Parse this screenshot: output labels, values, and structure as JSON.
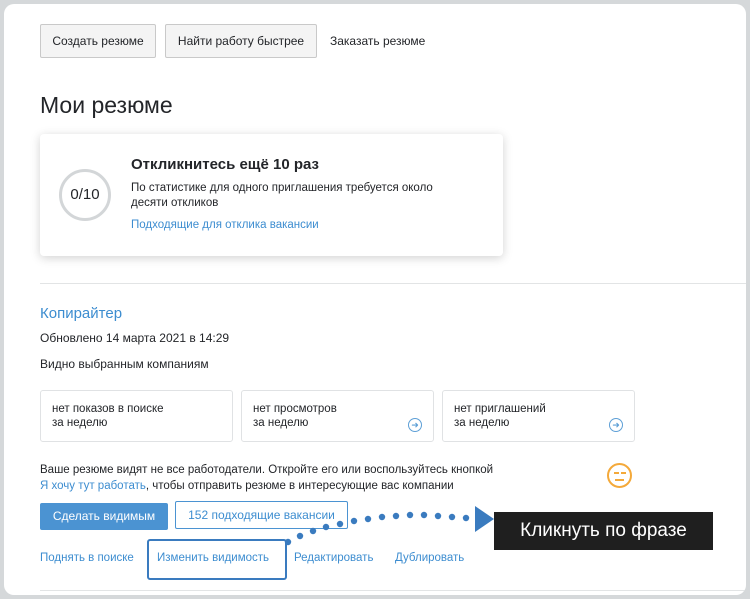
{
  "toolbar": {
    "create_resume": "Создать резюме",
    "find_job_faster": "Найти работу быстрее",
    "order_resume": "Заказать резюме"
  },
  "page_title": "Мои резюме",
  "respond_card": {
    "progress": "0/10",
    "title": "Откликнитесь ещё 10 раз",
    "text": "По статистике для одного приглашения требуется около десяти откликов",
    "link": "Подходящие для отклика вакансии"
  },
  "resume": {
    "title": "Копирайтер",
    "updated": "Обновлено 14 марта 2021 в 14:29",
    "visibility": "Видно выбранным компаниям",
    "stats": [
      {
        "line1": "нет показов в поиске",
        "line2": "за неделю"
      },
      {
        "line1": "нет просмотров",
        "line2": "за неделю"
      },
      {
        "line1": "нет приглашений",
        "line2": "за неделю"
      }
    ],
    "warning_text": "Ваше резюме видят не все работодатели. Откройте его или воспользуйтесь кнопкой",
    "warning_link": "Я хочу тут работать",
    "warning_tail": ", чтобы отправить резюме в интересующие вас компании",
    "make_visible": "Сделать видимым",
    "matching_vacancies": "152 подходящие вакансии",
    "actions": {
      "raise": "Поднять в поиске",
      "change_visibility": "Изменить видимость",
      "edit": "Редактировать",
      "duplicate": "Дублировать"
    }
  },
  "annotation": {
    "callout": "Кликнуть по фразе"
  },
  "colors": {
    "link": "#3d8dd0",
    "primary_button": "#4b93d2",
    "smiley": "#f4a93a",
    "callout_bg": "#1f1f1f",
    "highlight": "#3a7bbf"
  },
  "icons": {
    "stat_arrow": "arrow-circle-right-icon",
    "neutral_face": "neutral-face-icon"
  }
}
